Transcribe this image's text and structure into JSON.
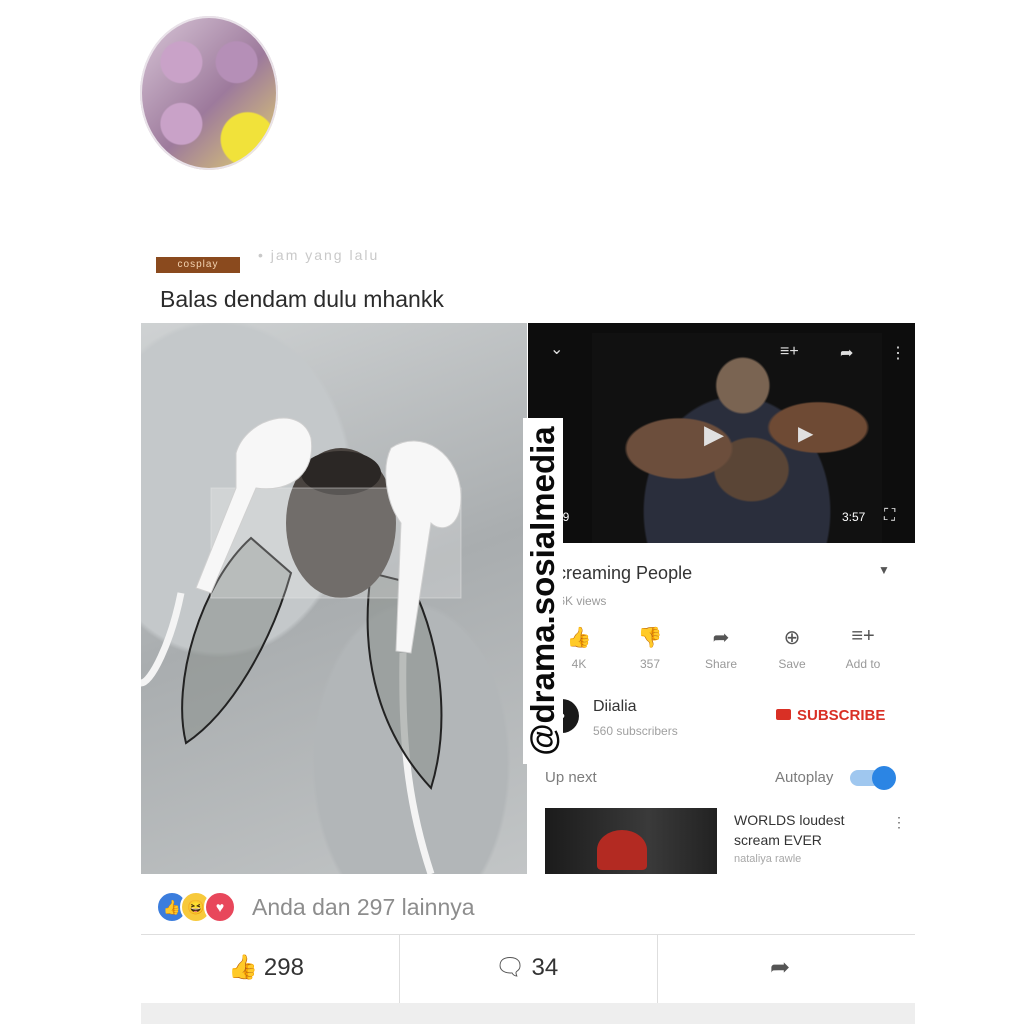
{
  "post": {
    "tag_badge": "cosplay",
    "faded_line": "• jam yang lalu",
    "text": "Balas dendam dulu mhankk"
  },
  "video": {
    "current_time": "0:09",
    "duration": "3:57",
    "icons": {
      "collapse": "chevron-down-icon",
      "add_to_playlist": "playlist-add-icon",
      "share": "share-arrow-icon",
      "more": "more-vert-icon",
      "fullscreen": "fullscreen-icon",
      "play": "play-icon"
    },
    "title": "Screaming People",
    "views": "486K views",
    "actions": [
      {
        "name": "like",
        "label": "4K",
        "icon": "thumbs-up-icon"
      },
      {
        "name": "dislike",
        "label": "357",
        "icon": "thumbs-down-icon"
      },
      {
        "name": "share",
        "label": "Share",
        "icon": "share-arrow-icon"
      },
      {
        "name": "save",
        "label": "Save",
        "icon": "save-icon"
      },
      {
        "name": "add-to",
        "label": "Add to",
        "icon": "playlist-add-icon"
      }
    ],
    "channel": {
      "name": "Diialia",
      "subscribers": "560 subscribers",
      "subscribe_label": "SUBSCRIBE"
    },
    "up_next_label": "Up next",
    "autoplay_label": "Autoplay",
    "autoplay_on": true,
    "next_video": {
      "title": "WORLDS loudest scream EVER",
      "author": "nataliya rawle"
    }
  },
  "watermark": "@drama.sosialmedia",
  "reactions": {
    "icons": [
      "like-reaction-icon",
      "haha-reaction-icon",
      "love-reaction-icon"
    ],
    "text": "Anda dan 297 lainnya"
  },
  "action_bar": {
    "likes": "298",
    "comments": "34"
  },
  "colors": {
    "facebook_blue": "#2f67d3",
    "youtube_red": "#d93025",
    "autoplay_blue": "#2b85e4"
  }
}
